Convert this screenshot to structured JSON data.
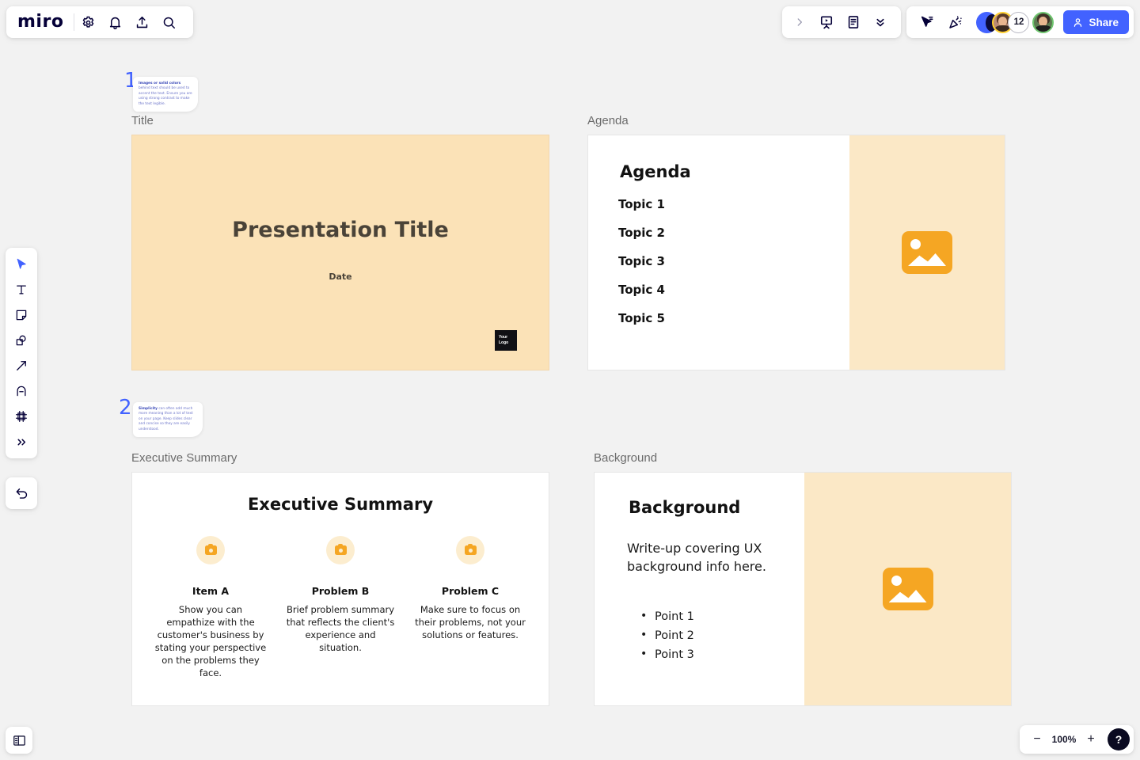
{
  "app": {
    "logo_text": "miro",
    "zoom_level": "100%",
    "help_label": "?"
  },
  "top_left_toolbar": {
    "items": [
      {
        "name": "settings-icon",
        "label": "Settings"
      },
      {
        "name": "notifications-icon",
        "label": "Notifications"
      },
      {
        "name": "upload-icon",
        "label": "Upload"
      },
      {
        "name": "search-icon",
        "label": "Search"
      }
    ]
  },
  "top_right_toolbar": {
    "group_a": [
      {
        "name": "chevron-right-icon",
        "label": "Expand"
      },
      {
        "name": "presentation-icon",
        "label": "Presentation mode"
      },
      {
        "name": "document-icon",
        "label": "Notes"
      },
      {
        "name": "chevron-double-down-icon",
        "label": "More"
      }
    ],
    "group_b": [
      {
        "name": "cursor-trail-icon",
        "label": "Follow cursor"
      },
      {
        "name": "party-popper-icon",
        "label": "Reactions"
      }
    ],
    "collaborators_count": "12",
    "share_label": "Share"
  },
  "left_toolbar": {
    "tools": [
      {
        "name": "cursor-tool",
        "label": "Select",
        "selected": true
      },
      {
        "name": "text-tool",
        "label": "Text"
      },
      {
        "name": "sticky-note-tool",
        "label": "Sticky note"
      },
      {
        "name": "shapes-tool",
        "label": "Shapes"
      },
      {
        "name": "arrow-tool",
        "label": "Connection line"
      },
      {
        "name": "pen-tool",
        "label": "Pen"
      },
      {
        "name": "frame-tool",
        "label": "Frame"
      },
      {
        "name": "more-tools",
        "label": "More tools"
      }
    ],
    "undo_label": "Undo"
  },
  "bottom_bar": {
    "panel_toggle": "Toggle panel",
    "zoom_out": "−",
    "zoom_in": "+"
  },
  "notes": [
    {
      "number": "1",
      "bold": "Images or solid colors",
      "text": " behind text should be used to accent the text. Ensure you are using strong contrast to make the text legible."
    },
    {
      "number": "2",
      "bold": "Simplicity",
      "text": " can often add much more meaning than a lot of text on your page. Keep slides clear and concise so they are easily understood."
    }
  ],
  "frames": {
    "title": {
      "label": "Title",
      "heading": "Presentation Title",
      "date": "Date",
      "logo": "Your Logo"
    },
    "agenda": {
      "label": "Agenda",
      "heading": "Agenda",
      "topics": [
        "Topic 1",
        "Topic 2",
        "Topic 3",
        "Topic 4",
        "Topic 5"
      ]
    },
    "executive_summary": {
      "label": "Executive Summary",
      "heading": "Executive Summary",
      "columns": [
        {
          "title": "Item A",
          "body": "Show you can empathize with the customer's business by stating your perspective on the problems they face."
        },
        {
          "title": "Problem B",
          "body": "Brief problem summary that reflects the client's experience and situation."
        },
        {
          "title": "Problem C",
          "body": "Make sure to focus on their problems, not your solutions or features."
        }
      ]
    },
    "background": {
      "label": "Background",
      "heading": "Background",
      "paragraph": "Write-up covering UX background info here.",
      "points": [
        "Point 1",
        "Point 2",
        "Point 3"
      ]
    }
  },
  "colors": {
    "brand": "#4262ff",
    "slide_peach": "#fbe2b7",
    "panel_peach": "#fbe8c6",
    "accent_orange": "#f5a623",
    "canvas": "#f2f2f2",
    "ink": "#050038"
  }
}
